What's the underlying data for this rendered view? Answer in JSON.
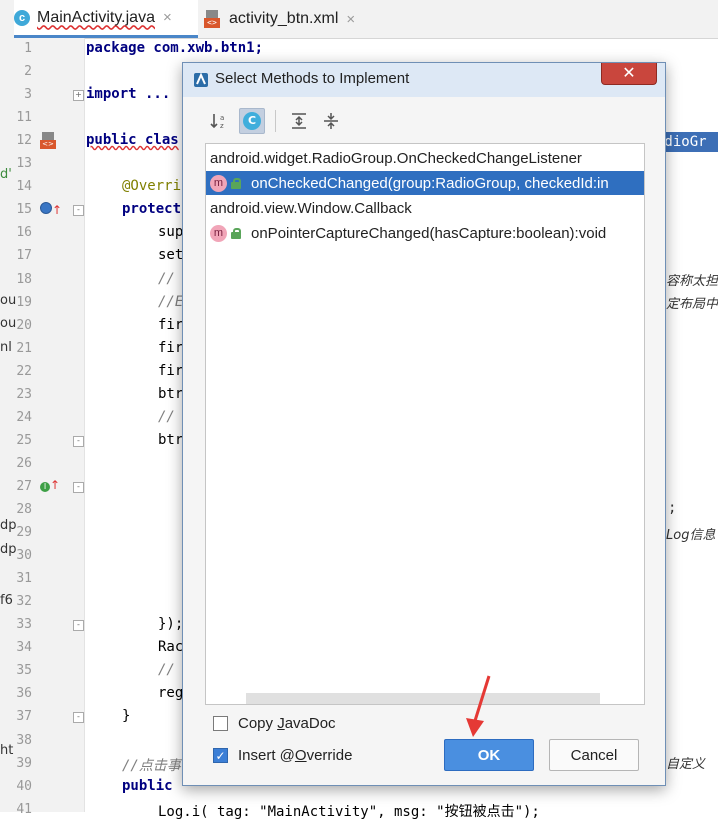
{
  "tabs": [
    {
      "label": "MainActivity.java",
      "icon": "java-class-icon",
      "close": "×"
    },
    {
      "label": "activity_btn.xml",
      "icon": "xml-file-icon",
      "close": "×"
    }
  ],
  "editor": {
    "lines": [
      {
        "num": "1",
        "text": "package com.xwb.btn1;"
      },
      {
        "num": "2",
        "text": ""
      },
      {
        "num": "3",
        "text": "import ..."
      },
      {
        "num": "11",
        "text": ""
      },
      {
        "num": "12",
        "text": "public clas"
      },
      {
        "num": "13",
        "text": ""
      },
      {
        "num": "14",
        "text": "@Overri"
      },
      {
        "num": "15",
        "text": "protect"
      },
      {
        "num": "16",
        "text": "sup"
      },
      {
        "num": "17",
        "text": "set"
      },
      {
        "num": "18",
        "text": "//"
      },
      {
        "num": "19",
        "text": "//E"
      },
      {
        "num": "20",
        "text": "fir"
      },
      {
        "num": "21",
        "text": "fir"
      },
      {
        "num": "22",
        "text": "fir"
      },
      {
        "num": "23",
        "text": "btr"
      },
      {
        "num": "24",
        "text": "//"
      },
      {
        "num": "25",
        "text": "btr"
      },
      {
        "num": "26",
        "text": ""
      },
      {
        "num": "27",
        "text": ""
      },
      {
        "num": "28",
        "text": ""
      },
      {
        "num": "29",
        "text": ""
      },
      {
        "num": "30",
        "text": ""
      },
      {
        "num": "31",
        "text": ""
      },
      {
        "num": "32",
        "text": ""
      },
      {
        "num": "33",
        "text": "});"
      },
      {
        "num": "34",
        "text": "Rac"
      },
      {
        "num": "35",
        "text": "//"
      },
      {
        "num": "36",
        "text": "reg"
      },
      {
        "num": "37",
        "text": "}"
      },
      {
        "num": "38",
        "text": ""
      },
      {
        "num": "39",
        "text": "//点击事"
      },
      {
        "num": "40",
        "text": "public"
      },
      {
        "num": "41",
        "text": "Log.i( tag: \"MainActivity\", msg: \"按钮被点击\");"
      }
    ],
    "right_bleed": {
      "radio_group": "adioGr",
      "line18": "容称太担",
      "line19": "定布局中",
      "line28": ";",
      "line29": "Log信息",
      "line39": "自定义"
    },
    "left_bleed": {
      "line14": "d'",
      "line19": "ou",
      "line20": "ou",
      "line21": "nl",
      "line28": "dp",
      "line29": "dp",
      "line32": "f6",
      "line39": "ht"
    }
  },
  "dialog": {
    "title": "Select Methods to Implement",
    "close": "✕",
    "toolbar": {
      "sort_alpha": "sort-alphabetically-icon",
      "show_classes": "C",
      "expand_all": "expand-all-icon",
      "collapse_all": "collapse-all-icon"
    },
    "items": [
      {
        "type": "group",
        "label": "android.widget.RadioGroup.OnCheckedChangeListener"
      },
      {
        "type": "method",
        "label": "onCheckedChanged(group:RadioGroup, checkedId:in",
        "selected": true,
        "icon": "m"
      },
      {
        "type": "group",
        "label": "android.view.Window.Callback"
      },
      {
        "type": "method",
        "label": "onPointerCaptureChanged(hasCapture:boolean):void",
        "selected": false,
        "icon": "m"
      }
    ],
    "copy_javadoc": {
      "pre": "Copy ",
      "u": "J",
      "post": "avaDoc",
      "checked": false
    },
    "insert_override": {
      "pre": "Insert @",
      "u": "O",
      "post": "verride",
      "checked": true
    },
    "ok_label": "OK",
    "cancel_label": "Cancel"
  },
  "colors": {
    "selection": "#2f6fc0",
    "ok_button": "#4a8fe0",
    "annotation_arrow": "#e53935"
  }
}
